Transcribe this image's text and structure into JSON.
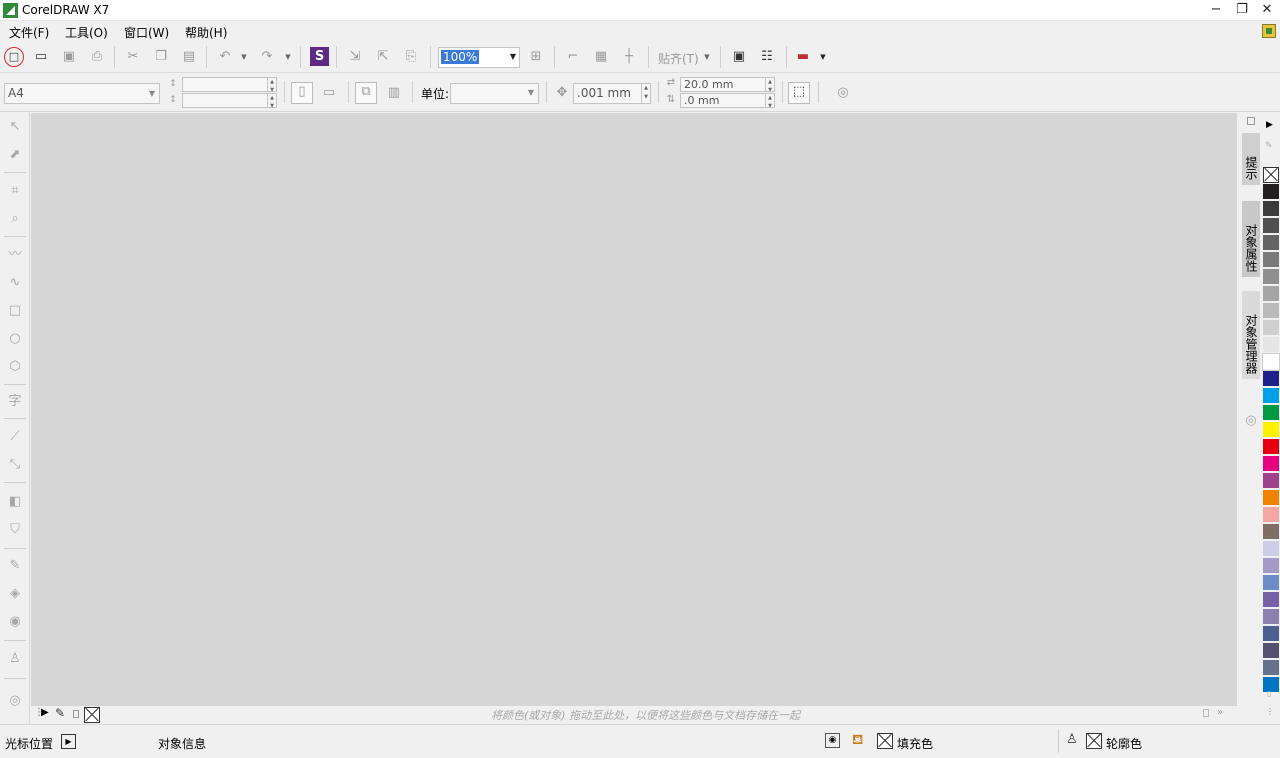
{
  "window": {
    "title": "CorelDRAW X7",
    "minimize_label": "−",
    "restore_label": "❐",
    "close_label": "✕"
  },
  "menu": [
    {
      "label": "文件(F)"
    },
    {
      "label": "工具(O)"
    },
    {
      "label": "窗口(W)"
    },
    {
      "label": "帮助(H)"
    }
  ],
  "standard_toolbar": {
    "zoom_level": "100%",
    "snap_label": "贴齐(T)"
  },
  "property_bar": {
    "page_size": "A4",
    "page_width": "",
    "page_height": "",
    "units_label": "单位:",
    "units_value": "",
    "nudge_value": ".001 mm",
    "duplicate_h": "20.0 mm",
    "duplicate_v": ".0 mm"
  },
  "dockers": {
    "tabs": [
      {
        "label": "提示"
      },
      {
        "label": "对象属性"
      },
      {
        "label": "对象管理器"
      }
    ]
  },
  "palette": {
    "colors": [
      "#231f20",
      "#3c3b3b",
      "#515050",
      "#666565",
      "#7b7a7a",
      "#908f8f",
      "#a6a5a5",
      "#bbbaba",
      "#d0cfcf",
      "#e6e5e5",
      "#ffffff",
      "#1d2088",
      "#00a0e9",
      "#009944",
      "#fff100",
      "#e60012",
      "#e4007f",
      "#a0418c",
      "#f08300",
      "#f4a6a3",
      "#7f6f63",
      "#cdcde6",
      "#a49ac8",
      "#6e8dc8",
      "#7660a6",
      "#8c80b0",
      "#4d5f8e",
      "#54506e",
      "#66718e",
      "#0075c2"
    ]
  },
  "document_palette": {
    "hint": "将颜色(或对象) 拖动至此处，以便将这些颜色与文档存储在一起"
  },
  "status": {
    "cursor_position": "光标位置",
    "object_info": "对象信息",
    "fill_label": "填充色",
    "outline_label": "轮廓色"
  }
}
